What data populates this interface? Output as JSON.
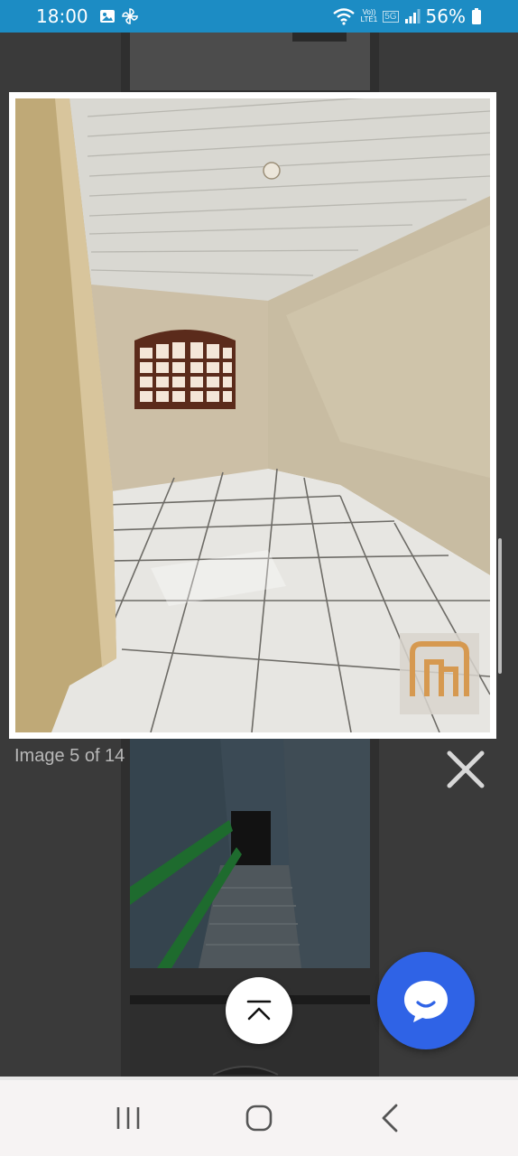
{
  "status_bar": {
    "time": "18:00",
    "network_label_top": "Vo))",
    "network_label_bottom": "LTE1",
    "network_type": "5G",
    "battery": "56%",
    "icons": [
      "gallery-icon",
      "pinwheel-icon",
      "wifi-icon",
      "signal-icon",
      "battery-icon"
    ]
  },
  "lightbox": {
    "caption": "Image 5 of 14",
    "watermark": "nh",
    "close_icon": "close-icon"
  },
  "fab": {
    "scroll_top_icon": "chevron-up-icon",
    "chat_icon": "chat-bubble-icon",
    "chat_color": "#2f63e6"
  },
  "nav": {
    "icons": [
      "recent-apps-icon",
      "home-icon",
      "back-icon"
    ]
  },
  "colors": {
    "status_bar": "#1c8cc4",
    "background": "#3a3a3a",
    "nav_bar": "#f6f3f3"
  }
}
